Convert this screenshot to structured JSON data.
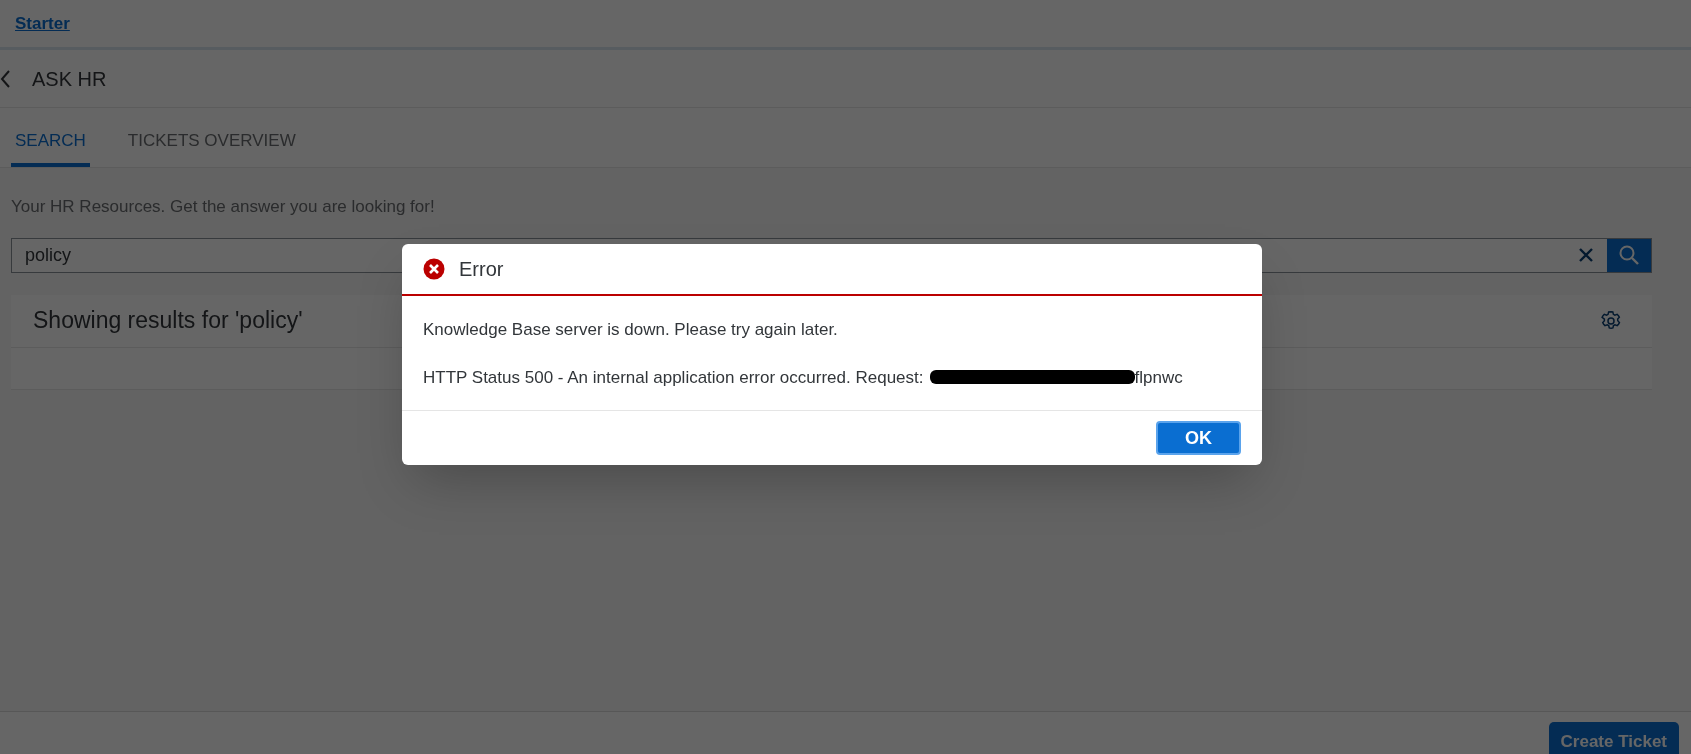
{
  "breadcrumb": {
    "link": "Starter"
  },
  "header": {
    "title": "ASK HR"
  },
  "tabs": [
    {
      "label": "SEARCH",
      "selected": true
    },
    {
      "label": "TICKETS OVERVIEW",
      "selected": false
    }
  ],
  "tagline": "Your HR Resources. Get the answer you are looking for!",
  "search": {
    "value": "policy"
  },
  "results": {
    "title": "Showing results for 'policy'"
  },
  "footer": {
    "button": "Create Ticket"
  },
  "dialog": {
    "title": "Error",
    "message": "Knowledge Base server is down. Please try again later.",
    "detail_prefix": "HTTP Status 500 - An internal application error occurred. Request:",
    "detail_suffix": "flpnwc",
    "button": "OK"
  }
}
